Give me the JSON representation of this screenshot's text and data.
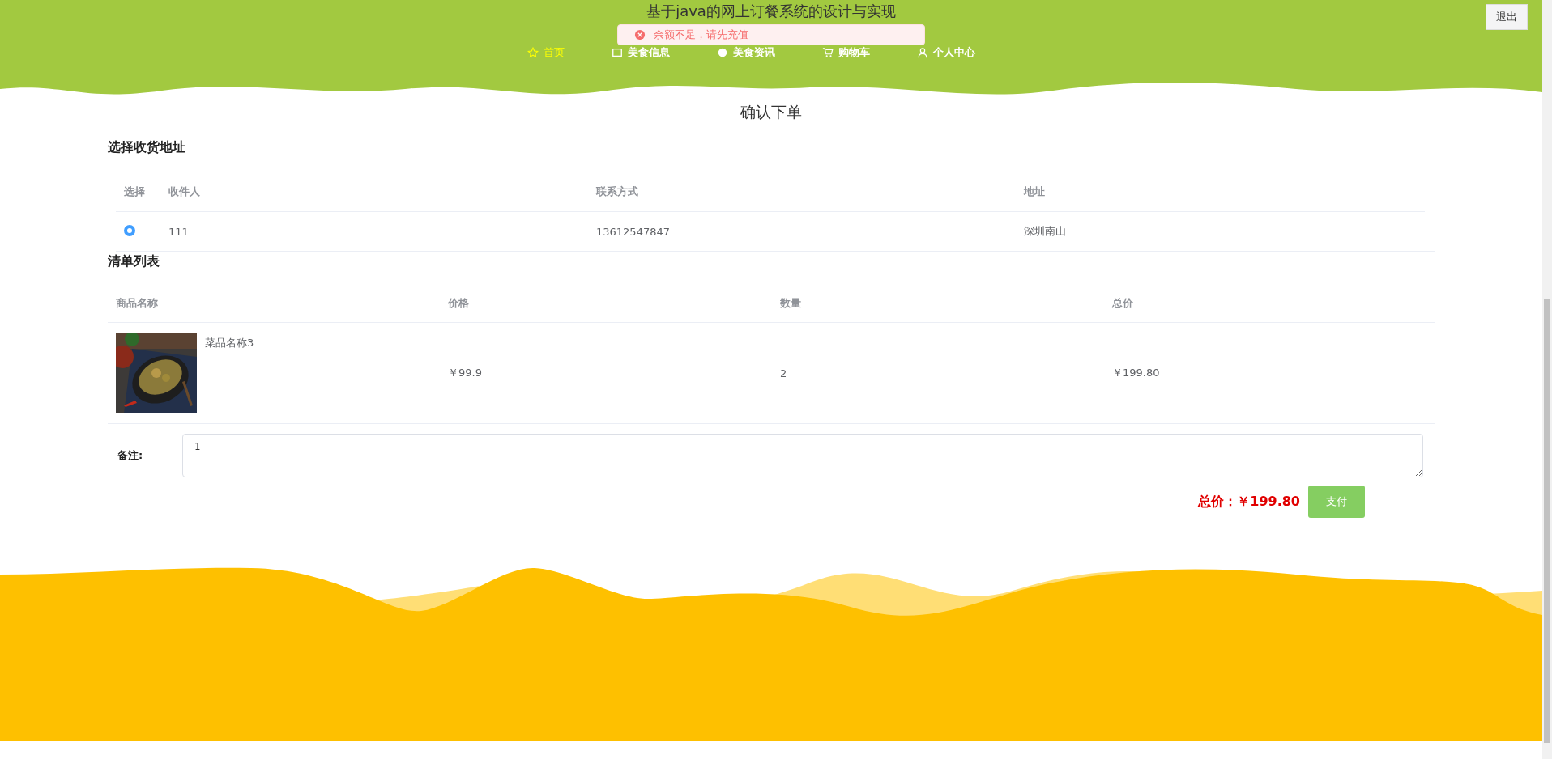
{
  "header": {
    "title": "基于java的网上订餐系统的设计与实现",
    "logout": "退出",
    "nav": [
      {
        "label": "首页",
        "selected": true
      },
      {
        "label": "美食信息",
        "selected": false
      },
      {
        "label": "美食资讯",
        "selected": false
      },
      {
        "label": "购物车",
        "selected": false
      },
      {
        "label": "个人中心",
        "selected": false
      }
    ]
  },
  "toast": {
    "message": "余额不足，请先充值"
  },
  "page_title": "确认下单",
  "address": {
    "heading": "选择收货地址",
    "columns": [
      "选择",
      "收件人",
      "联系方式",
      "地址"
    ],
    "rows": [
      {
        "selected": true,
        "name": "111",
        "phone": "13612547847",
        "address": "深圳南山"
      }
    ]
  },
  "items": {
    "heading": "清单列表",
    "columns": [
      "商品名称",
      "价格",
      "数量",
      "总价"
    ],
    "rows": [
      {
        "name": "菜品名称3",
        "price": "￥99.9",
        "quantity": "2",
        "total": "￥199.80"
      }
    ]
  },
  "remark": {
    "label": "备注:",
    "value": "1"
  },
  "total": {
    "label": "总价：",
    "amount": "￥199.80"
  },
  "pay_button": "支付"
}
